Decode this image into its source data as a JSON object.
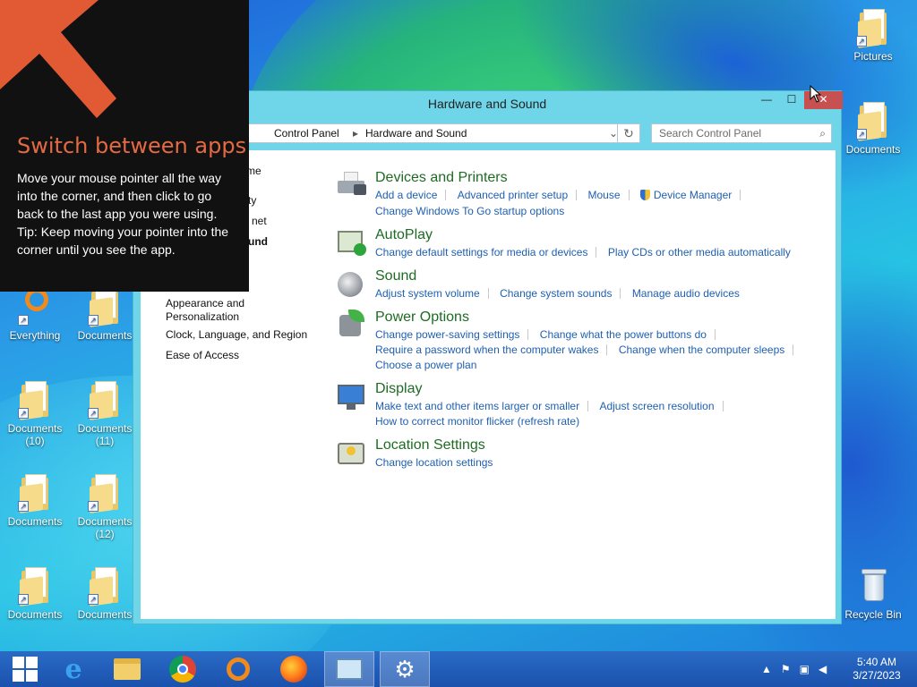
{
  "window": {
    "title": "Hardware and Sound",
    "breadcrumb": [
      "Control Panel",
      "Hardware and Sound"
    ],
    "search_placeholder": "Search Control Panel"
  },
  "left_nav": {
    "items": [
      {
        "label": "me",
        "bold": false
      },
      {
        "label": "ty",
        "bold": false
      },
      {
        "label": "net",
        "bold": false
      },
      {
        "label": "und",
        "bold": true
      },
      {
        "label": "Appearance and Personalization",
        "bold": false
      },
      {
        "label": "Clock, Language, and Region",
        "bold": false
      },
      {
        "label": "Ease of Access",
        "bold": false
      }
    ]
  },
  "categories": [
    {
      "title": "Devices and Printers",
      "icon": "printer-icon",
      "rows": [
        [
          "Add a device",
          "Advanced printer setup",
          "Mouse",
          "Device Manager"
        ],
        [
          "Change Windows To Go startup options"
        ]
      ]
    },
    {
      "title": "AutoPlay",
      "icon": "autoplay-icon",
      "rows": [
        [
          "Change default settings for media or devices",
          "Play CDs or other media automatically"
        ]
      ]
    },
    {
      "title": "Sound",
      "icon": "speaker-icon",
      "rows": [
        [
          "Adjust system volume",
          "Change system sounds",
          "Manage audio devices"
        ]
      ]
    },
    {
      "title": "Power Options",
      "icon": "power-options-icon",
      "rows": [
        [
          "Change power-saving settings",
          "Change what the power buttons do"
        ],
        [
          "Require a password when the computer wakes",
          "Change when the computer sleeps"
        ],
        [
          "Choose a power plan"
        ]
      ]
    },
    {
      "title": "Display",
      "icon": "display-icon",
      "rows": [
        [
          "Make text and other items larger or smaller",
          "Adjust screen resolution"
        ],
        [
          "How to correct monitor flicker (refresh rate)"
        ]
      ]
    },
    {
      "title": "Location Settings",
      "icon": "location-icon",
      "rows": [
        [
          "Change location settings"
        ]
      ]
    }
  ],
  "tip": {
    "title": "Switch between apps",
    "body": "Move your mouse pointer all the way into the corner, and then click to go back to the last app you were using.",
    "tip": "Tip: Keep moving your pointer into the corner until you see the app."
  },
  "desktop_icons": [
    {
      "label": "Pictures"
    },
    {
      "label": "Documents"
    },
    {
      "label": "Everything"
    },
    {
      "label": "Documents"
    },
    {
      "label": "Documents (10)"
    },
    {
      "label": "Documents (11)"
    },
    {
      "label": "Documents"
    },
    {
      "label": "Documents (12)"
    },
    {
      "label": "Documents"
    },
    {
      "label": "Documents"
    },
    {
      "label": "Recycle Bin"
    }
  ],
  "taskbar": {
    "items": [
      "start-icon",
      "internet-explorer-icon",
      "file-explorer-icon",
      "chrome-icon",
      "search-everything-icon",
      "firefox-icon",
      "control-panel-icon",
      "settings-icon"
    ],
    "time": "5:40 AM",
    "date": "3/27/2023"
  },
  "colors": {
    "category_title": "#1e6b23",
    "link": "#1f5fb0",
    "tip_title": "#e36a43",
    "window_frame": "#6fd6ea",
    "close_button": "#c75050"
  }
}
